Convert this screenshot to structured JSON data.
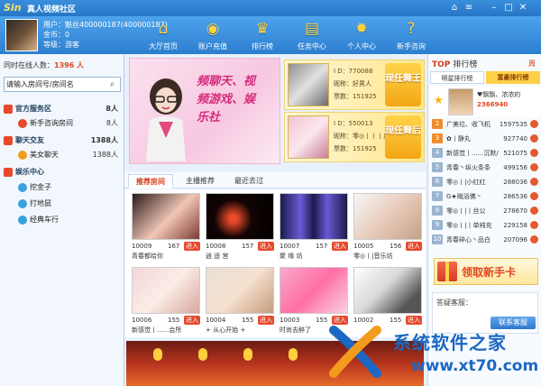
{
  "window": {
    "logo": "Sin",
    "title": "真人视频社区",
    "home_icon": "home-icon",
    "menu_icon": "menu-icon"
  },
  "user": {
    "name": "用户：魁丝400000187(400000187)",
    "coins": "金币：0",
    "level": "等级：游客"
  },
  "nav": [
    {
      "label": "大厅首页",
      "icon": "house-icon",
      "glyph": "⌂"
    },
    {
      "label": "账户充值",
      "icon": "coins-icon",
      "glyph": "◉"
    },
    {
      "label": "排行榜",
      "icon": "trophy-icon",
      "glyph": "♛"
    },
    {
      "label": "任务中心",
      "icon": "tasks-icon",
      "glyph": "▤"
    },
    {
      "label": "个人中心",
      "icon": "gear-icon",
      "glyph": "✹"
    },
    {
      "label": "新手咨询",
      "icon": "question-icon",
      "glyph": "?"
    }
  ],
  "left": {
    "online_label": "同时在线人数：",
    "online_count": "1396 人",
    "search_placeholder": "请输入房间号/房间名",
    "tree": [
      {
        "label": "官方服务区",
        "count": "8人",
        "type": "cat",
        "color": "#e8482c"
      },
      {
        "label": "新手咨询房间",
        "count": "8人",
        "type": "sub",
        "color": "#e8482c"
      },
      {
        "label": "聊天交友",
        "count": "1388人",
        "type": "cat",
        "color": "#e8482c"
      },
      {
        "label": "美女聊天",
        "count": "1388人",
        "type": "sub",
        "color": "#f39b1d"
      },
      {
        "label": "娱乐中心",
        "count": "",
        "type": "cat",
        "color": "#e8482c"
      },
      {
        "label": "挖金子",
        "count": "",
        "type": "sub",
        "color": "#3aa1e0"
      },
      {
        "label": "打地鼠",
        "count": "",
        "type": "sub",
        "color": "#3aa1e0"
      },
      {
        "label": "经典车行",
        "count": "",
        "type": "sub",
        "color": "#3aa1e0"
      }
    ]
  },
  "banner": {
    "line1": "频聊天、视",
    "line2": "频游戏、娱",
    "line3": "乐社"
  },
  "dancers": [
    {
      "id": "I D：770088",
      "nick": "昵称：好男人",
      "votes": "票数：151925",
      "badge": "现任舞王"
    },
    {
      "id": "I D：550013",
      "nick": "昵称：零◎丨丨丨丝公",
      "votes": "票数：151925",
      "badge": "现任舞后"
    }
  ],
  "tabs": [
    "推荐房间",
    "主播推荐",
    "最近去过"
  ],
  "rooms": [
    {
      "id": "10009",
      "viewers": "167",
      "name": "青春都给你",
      "enter": "进入"
    },
    {
      "id": "10008",
      "viewers": "157",
      "name": "逍 遥 宫",
      "enter": "进入"
    },
    {
      "id": "10007",
      "viewers": "157",
      "name": "聚 缘 坊",
      "enter": "进入"
    },
    {
      "id": "10005",
      "viewers": "156",
      "name": "零◎丨|音乐坊",
      "enter": "进入"
    },
    {
      "id": "10006",
      "viewers": "155",
      "name": "新感觉丨......会所",
      "enter": "进入"
    },
    {
      "id": "10004",
      "viewers": "155",
      "name": "+ 从心开始 +",
      "enter": "进入"
    },
    {
      "id": "10003",
      "viewers": "155",
      "name": "时尚去醉了",
      "enter": "进入"
    },
    {
      "id": "10002",
      "viewers": "155",
      "name": "",
      "enter": "进入"
    }
  ],
  "right": {
    "title": "TOP",
    "subtitle": "排行榜",
    "tab_right": "周",
    "tabs": [
      "明星排行榜",
      "富豪排行榜"
    ],
    "first": {
      "name": "♥飘飘、浓浓的",
      "score": "2366940"
    },
    "ranks": [
      {
        "no": "2",
        "name": "广美垃、收飞机",
        "score": "1597535"
      },
      {
        "no": "3",
        "name": "✿丨静丸",
        "score": "927740"
      },
      {
        "no": "4",
        "name": "新感觉丨......沉默/",
        "score": "521075"
      },
      {
        "no": "5",
        "name": "青春丶纵火条条",
        "score": "499156"
      },
      {
        "no": "6",
        "name": "零◎丨|小红红",
        "score": "288036"
      },
      {
        "no": "7",
        "name": "G★飚浴佛丶",
        "score": "286536"
      },
      {
        "no": "8",
        "name": "零◎丨|丨丝公",
        "score": "278670"
      },
      {
        "no": "9",
        "name": "零◎丨|丨单纯充",
        "score": "229158"
      },
      {
        "no": "10",
        "name": "青春碎心丶品白",
        "score": "207096"
      }
    ],
    "new_card": "领取新手卡",
    "service_label": "答疑客服：",
    "service_button": "联系客服"
  },
  "watermark": {
    "line1": "系统软件之家",
    "line2": "www.xt70.com"
  }
}
